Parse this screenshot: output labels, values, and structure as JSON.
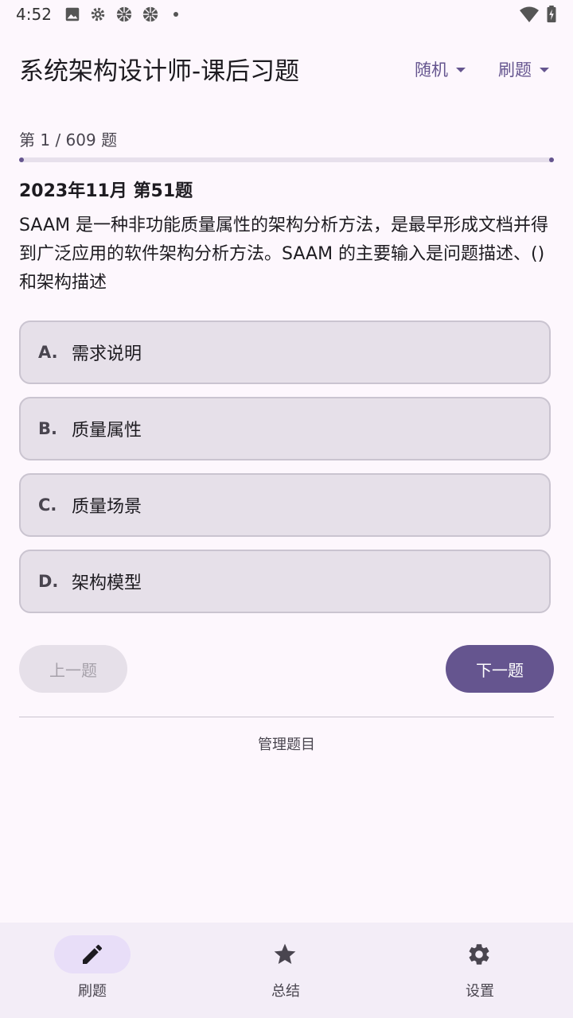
{
  "status_bar": {
    "time": "4:52",
    "icons": [
      "image-icon",
      "gear-icon",
      "aperture-icon",
      "aperture-icon",
      "dot-icon",
      "wifi-icon",
      "battery-icon"
    ]
  },
  "header": {
    "title": "系统架构设计师-课后习题",
    "menu_order": "随机",
    "menu_mode": "刷题"
  },
  "progress": {
    "text": "第 1 / 609 题",
    "current": 1,
    "total": 609
  },
  "question": {
    "source": "2023年11月 第51题",
    "text": "SAAM 是一种非功能质量属性的架构分析方法，是最早形成文档并得到广泛应用的软件架构分析方法。SAAM 的主要输入是问题描述、() 和架构描述",
    "options": [
      {
        "letter": "A.",
        "text": "需求说明"
      },
      {
        "letter": "B.",
        "text": "质量属性"
      },
      {
        "letter": "C.",
        "text": "质量场景"
      },
      {
        "letter": "D.",
        "text": "架构模型"
      }
    ]
  },
  "controls": {
    "prev": "上一题",
    "next": "下一题",
    "manage": "管理题目"
  },
  "bottom_nav": {
    "items": [
      {
        "label": "刷题",
        "icon": "pencil-icon",
        "active": true
      },
      {
        "label": "总结",
        "icon": "star-icon",
        "active": false
      },
      {
        "label": "设置",
        "icon": "gear-icon",
        "active": false
      }
    ]
  },
  "colors": {
    "primary": "#65558f",
    "background": "#fdf7fd",
    "option_bg": "#e6e0e9",
    "nav_bg": "#f3edf7",
    "pill": "#e8def8"
  }
}
